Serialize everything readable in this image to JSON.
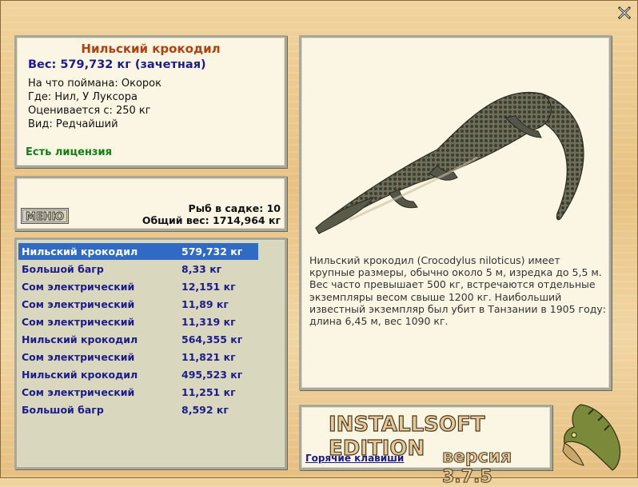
{
  "fish": {
    "title": "Нильский крокодил",
    "weight_line": "Вес: 579,732 кг (зачетная)",
    "bait": "На что поймана: Окорок",
    "place": "Где: Нил, У Луксора",
    "valued": "Оценивается с: 250 кг",
    "kind": "Вид: Редчайший",
    "license": "Есть лицензия"
  },
  "cage": {
    "menu_label": "МЕНЮ",
    "fish_count": "Рыб в садке: 10",
    "total_weight": "Общий вес: 1714,964 кг"
  },
  "catch_list": [
    {
      "name": "Нильский крокодил",
      "weight": "579,732 кг",
      "selected": true
    },
    {
      "name": "Большой багр",
      "weight": "8,33 кг"
    },
    {
      "name": "Сом электрический",
      "weight": "12,151 кг"
    },
    {
      "name": "Сом электрический",
      "weight": "11,89 кг"
    },
    {
      "name": "Сом электрический",
      "weight": "11,319 кг"
    },
    {
      "name": "Нильский крокодил",
      "weight": "564,355 кг"
    },
    {
      "name": "Сом электрический",
      "weight": "11,821 кг"
    },
    {
      "name": "Нильский крокодил",
      "weight": "495,523 кг"
    },
    {
      "name": "Сом электрический",
      "weight": "11,251 кг"
    },
    {
      "name": "Большой багр",
      "weight": "8,592 кг"
    }
  ],
  "description": "Нильский крокодил (Crocodylus niloticus) имеет крупные размеры, обычно около 5 м, изредка до 5,5 м. Вес часто превышает 500 кг, встречаются отдельные экземпляры весом свыше 1200 кг. Наибольший известный экземпляр был убит в Танзании в 1905 году: длина 6,45 м, вес 1090 кг.",
  "brand": {
    "title": "INSTALLSOFT EDITION",
    "hotkeys": "Горячие клавиши",
    "version": "версия 3.7.5"
  },
  "icons": {
    "close": "close-icon",
    "crocodile": "crocodile-image",
    "pike": "pike-icon"
  },
  "colors": {
    "title": "#b3400d",
    "list_text": "#1c1c8c",
    "selection": "#316ac5",
    "license": "#157d15"
  }
}
